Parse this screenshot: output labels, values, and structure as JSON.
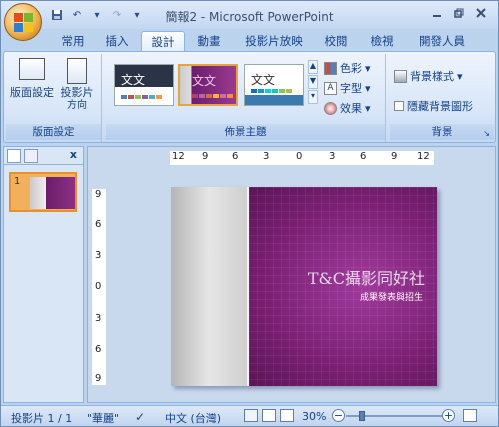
{
  "window": {
    "title": "簡報2 - Microsoft PowerPoint"
  },
  "qat": {
    "undo": "↶",
    "redo": "↷",
    "more": "▾"
  },
  "tabs": [
    "常用",
    "插入",
    "設計",
    "動畫",
    "投影片放映",
    "校閱",
    "檢視",
    "開發人員"
  ],
  "active_tab": "設計",
  "ribbon": {
    "page_setup": {
      "btn1": "版面設定",
      "btn2_line1": "投影片",
      "btn2_line2": "方向",
      "group_label": "版面設定"
    },
    "themes": {
      "thumb_text": "文文",
      "group_label": "佈景主題",
      "colors": "色彩",
      "fonts": "字型",
      "effects": "效果"
    },
    "background": {
      "styles": "背景樣式",
      "hide": "隱藏背景圖形",
      "group_label": "背景"
    }
  },
  "left_pane": {
    "close": "x",
    "slide_number": "1"
  },
  "ruler": {
    "h": [
      "12",
      "9",
      "6",
      "3",
      "0",
      "3",
      "6",
      "9",
      "12"
    ],
    "v": [
      "9",
      "6",
      "3",
      "0",
      "3",
      "6",
      "9"
    ]
  },
  "slide": {
    "title": "T&C攝影同好社",
    "subtitle": "成果發表與招生"
  },
  "status": {
    "slide": "投影片 1 / 1",
    "theme": "\"華麗\"",
    "lang": "中文 (台灣)",
    "zoom": "30%"
  }
}
